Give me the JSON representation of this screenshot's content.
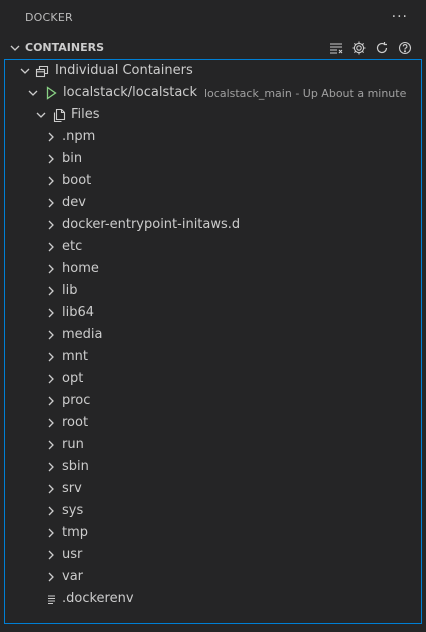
{
  "view": {
    "title": "DOCKER",
    "more_icon": "ellipsis-icon"
  },
  "section": {
    "title": "CONTAINERS",
    "actions": [
      "group-by-icon",
      "gear-icon",
      "refresh-icon",
      "help-icon"
    ]
  },
  "tree": {
    "group": {
      "label": "Individual Containers",
      "icon": "containers-icon"
    },
    "container": {
      "label": "localstack/localstack",
      "description": "localstack_main - Up About a minute",
      "icon": "play-icon"
    },
    "files": {
      "label": "Files",
      "icon": "files-icon"
    },
    "folders": [
      ".npm",
      "bin",
      "boot",
      "dev",
      "docker-entrypoint-initaws.d",
      "etc",
      "home",
      "lib",
      "lib64",
      "media",
      "mnt",
      "opt",
      "proc",
      "root",
      "run",
      "sbin",
      "srv",
      "sys",
      "tmp",
      "usr",
      "var"
    ],
    "file": {
      "label": ".dockerenv",
      "icon": "file-lines-icon"
    }
  },
  "colors": {
    "background": "#252526",
    "focus_border": "#007fd4",
    "play_green": "#89d185",
    "text": "#cccccc"
  }
}
